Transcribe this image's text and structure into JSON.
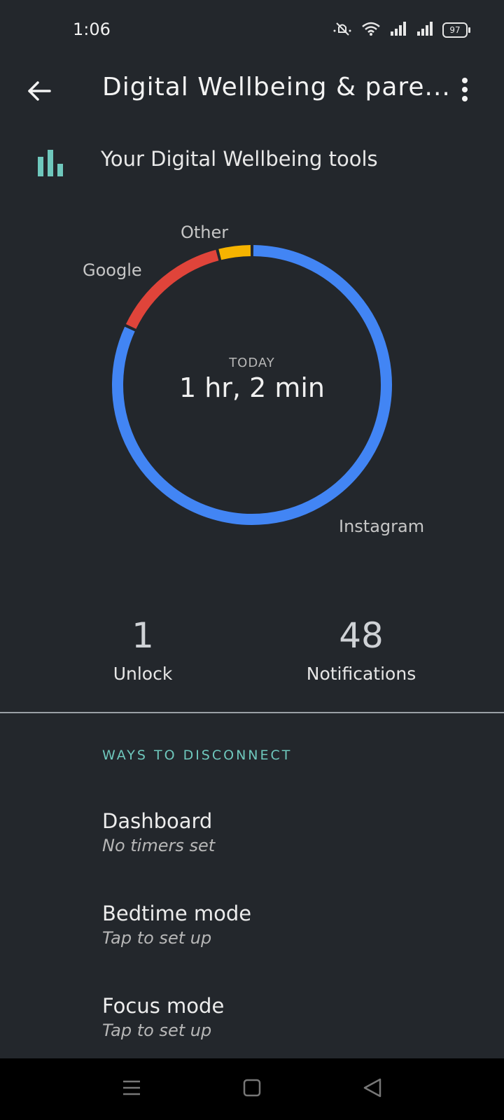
{
  "status_bar": {
    "time": "1:06",
    "battery": "97"
  },
  "top_bar": {
    "title": "Digital Wellbeing & pare..."
  },
  "tools_row": {
    "label": "Your Digital Wellbeing tools"
  },
  "chart_data": {
    "type": "pie",
    "categories": [
      "Other",
      "Google",
      "Instagram"
    ],
    "values": [
      0.04,
      0.14,
      0.82
    ],
    "colors": [
      "#f6b400",
      "#e0443a",
      "#4285f4"
    ],
    "center_caption": "TODAY",
    "center_value": "1 hr, 2 min"
  },
  "stats": {
    "unlock_value": "1",
    "unlock_label": "Unlock",
    "notifications_value": "48",
    "notifications_label": "Notifications"
  },
  "section": {
    "header": "WAYS TO DISCONNECT",
    "items": [
      {
        "title": "Dashboard",
        "subtitle": "No timers set"
      },
      {
        "title": "Bedtime mode",
        "subtitle": "Tap to set up"
      },
      {
        "title": "Focus mode",
        "subtitle": "Tap to set up"
      }
    ]
  },
  "icons": {
    "back": "arrow-left-icon",
    "more": "more-vert-icon",
    "tools": "bar-chart-icon",
    "nav_menu": "menu-icon",
    "nav_home": "home-square-icon",
    "nav_back": "triangle-back-icon"
  }
}
